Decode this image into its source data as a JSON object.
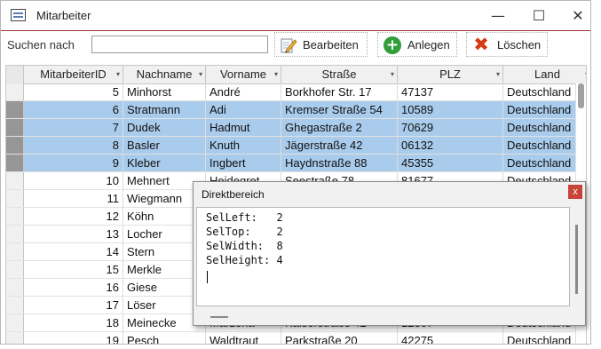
{
  "window": {
    "title": "Mitarbeiter",
    "minimize": "—",
    "maximize": "☐",
    "close": "✕"
  },
  "toolbar": {
    "search_label": "Suchen nach",
    "search_value": "",
    "edit_label": "Bearbeiten",
    "new_label": "Anlegen",
    "delete_label": "Löschen",
    "plus_glyph": "+",
    "x_glyph": "✖"
  },
  "grid": {
    "columns": [
      "MitarbeiterID",
      "Nachname",
      "Vorname",
      "Straße",
      "PLZ",
      "Land"
    ],
    "arrow": "▾",
    "rows": [
      {
        "id": "5",
        "nachname": "Minhorst",
        "vorname": "André",
        "strasse": "Borkhofer Str. 17",
        "plz": "47137",
        "land": "Deutschland",
        "selected": false
      },
      {
        "id": "6",
        "nachname": "Stratmann",
        "vorname": "Adi",
        "strasse": "Kremser Straße 54",
        "plz": "10589",
        "land": "Deutschland",
        "selected": true
      },
      {
        "id": "7",
        "nachname": "Dudek",
        "vorname": "Hadmut",
        "strasse": "Ghegastraße 2",
        "plz": "70629",
        "land": "Deutschland",
        "selected": true
      },
      {
        "id": "8",
        "nachname": "Basler",
        "vorname": "Knuth",
        "strasse": "Jägerstraße 42",
        "plz": "06132",
        "land": "Deutschland",
        "selected": true
      },
      {
        "id": "9",
        "nachname": "Kleber",
        "vorname": "Ingbert",
        "strasse": "Haydnstraße 88",
        "plz": "45355",
        "land": "Deutschland",
        "selected": true
      },
      {
        "id": "10",
        "nachname": "Mehnert",
        "vorname": "Heidegret",
        "strasse": "Seestraße 78",
        "plz": "81677",
        "land": "Deutschland",
        "selected": false
      },
      {
        "id": "11",
        "nachname": "Wiegmann",
        "vorname": "",
        "strasse": "",
        "plz": "",
        "land": "",
        "selected": false
      },
      {
        "id": "12",
        "nachname": "Köhn",
        "vorname": "",
        "strasse": "",
        "plz": "",
        "land": "",
        "selected": false
      },
      {
        "id": "13",
        "nachname": "Locher",
        "vorname": "",
        "strasse": "",
        "plz": "",
        "land": "",
        "selected": false
      },
      {
        "id": "14",
        "nachname": "Stern",
        "vorname": "",
        "strasse": "",
        "plz": "",
        "land": "",
        "selected": false
      },
      {
        "id": "15",
        "nachname": "Merkle",
        "vorname": "",
        "strasse": "",
        "plz": "",
        "land": "",
        "selected": false
      },
      {
        "id": "16",
        "nachname": "Giese",
        "vorname": "",
        "strasse": "",
        "plz": "",
        "land": "",
        "selected": false
      },
      {
        "id": "17",
        "nachname": "Löser",
        "vorname": "",
        "strasse": "",
        "plz": "",
        "land": "",
        "selected": false
      },
      {
        "id": "18",
        "nachname": "Meinecke",
        "vorname": "Marzena",
        "strasse": "Kaiserstraße 42",
        "plz": "12307",
        "land": "Deutschland",
        "selected": false
      },
      {
        "id": "19",
        "nachname": "Pesch",
        "vorname": "Waldtraut",
        "strasse": "Parkstraße 20",
        "plz": "42275",
        "land": "Deutschland",
        "selected": false
      }
    ]
  },
  "immediate": {
    "title": "Direktbereich",
    "close": "x",
    "lines": [
      "SelLeft:   2",
      "SelTop:    2",
      "SelWidth:  8",
      "SelHeight: 4"
    ]
  },
  "colors": {
    "selection": "#a9cbec",
    "title_border": "#a23232",
    "close_red": "#c8433a"
  }
}
